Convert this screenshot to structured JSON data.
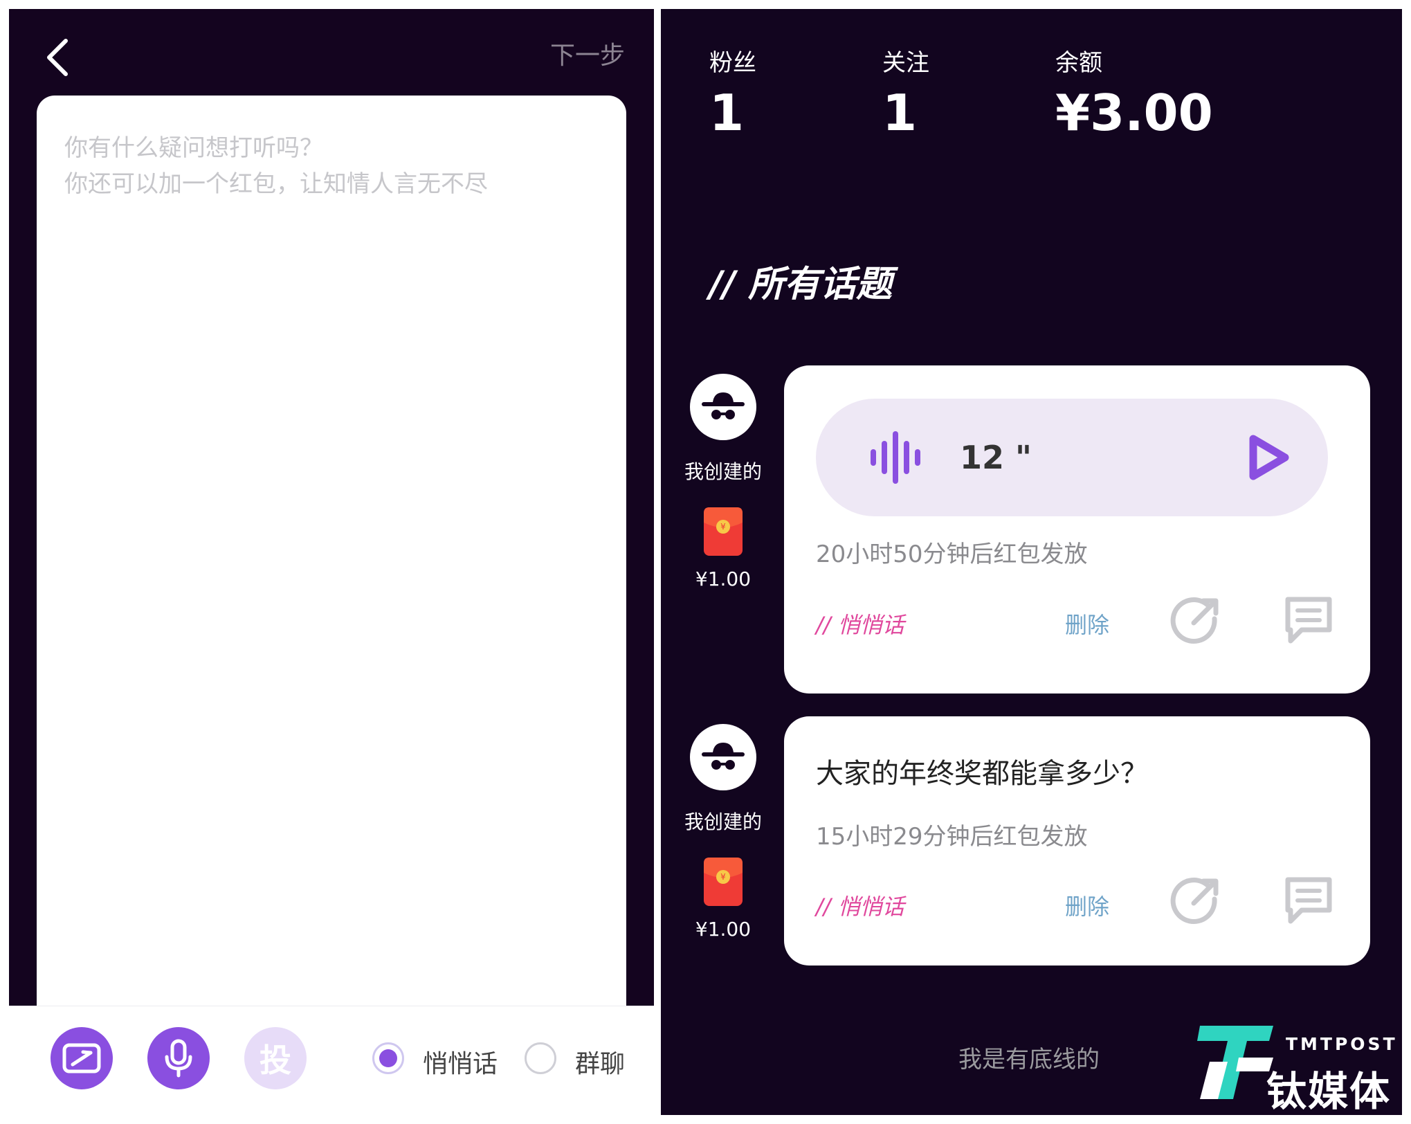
{
  "compose": {
    "next_step_label": "下一步",
    "placeholder": "你有什么疑问想打听吗？\n你还可以加一个红包，让知情人言无不尽",
    "tou_label": "投",
    "option_whisper": "悄悄话",
    "option_group": "群聊",
    "selected_option": "悄悄话"
  },
  "profile": {
    "fans_label": "粉丝",
    "fans_value": "1",
    "follow_label": "关注",
    "follow_value": "1",
    "balance_label": "余额",
    "balance_value": "¥3.00"
  },
  "topics": {
    "section_title": "// 所有话题",
    "items": [
      {
        "creator_label": "我创建的",
        "amount": "¥1.00",
        "voice_duration": "12 \"",
        "countdown": "20小时50分钟后红包发放",
        "tag": "// 悄悄话",
        "delete_label": "删除"
      },
      {
        "creator_label": "我创建的",
        "amount": "¥1.00",
        "question": "大家的年终奖都能拿多少？",
        "countdown": "15小时29分钟后红包发放",
        "tag": "// 悄悄话",
        "delete_label": "删除"
      }
    ],
    "footer": "我是有底线的"
  },
  "watermark": {
    "brand_en": "TMTPOST",
    "brand_cn": "钛媒体"
  },
  "colors": {
    "background_dark": "#14041f",
    "accent_purple": "#8a4fe0",
    "tag_pink": "#e0489d",
    "delete_blue": "#6fa3c8",
    "logo_teal": "#2fd4c0"
  }
}
